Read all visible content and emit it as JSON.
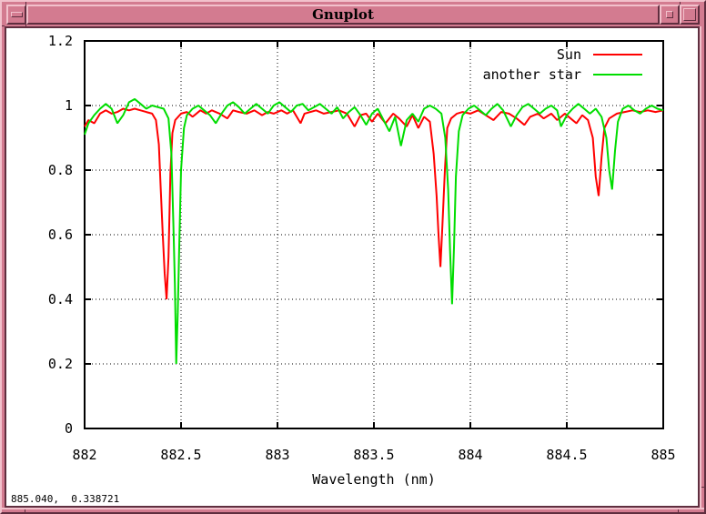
{
  "window": {
    "title": "Gnuplot",
    "icons": {
      "menu_button": "horizontal-dash",
      "minimize_button": "small-square",
      "maximize_button": "large-square"
    }
  },
  "status": {
    "coordinates": "885.040,  0.338721"
  },
  "colors": {
    "frame_face": "#d37b90",
    "frame_light": "#f2c1cc",
    "frame_dark": "#5f2e3f",
    "plot_background": "#ffffff",
    "axis": "#000000",
    "grid": "#000000",
    "sun": "#ff0000",
    "another_star": "#00dd00"
  },
  "chart_data": {
    "type": "line",
    "title": "",
    "xlabel": "Wavelength (nm)",
    "ylabel": "",
    "xlim": [
      882,
      885
    ],
    "ylim": [
      0,
      1.2
    ],
    "grid": "dotted lines at major ticks, mirrored inward ticks on all four borders",
    "legend_position": "inside top-right",
    "x_ticks": {
      "values": [
        882,
        882.5,
        883,
        883.5,
        884,
        884.5,
        885
      ],
      "labels": [
        "882",
        "882.5",
        "883",
        "883.5",
        "884",
        "884.5",
        "885"
      ]
    },
    "y_ticks": {
      "values": [
        0,
        0.2,
        0.4,
        0.6,
        0.8,
        1,
        1.2
      ],
      "labels": [
        "0",
        "0.2",
        "0.4",
        "0.6",
        "0.8",
        "1",
        "1.2"
      ]
    },
    "series": [
      {
        "name": "Sun",
        "color": "#ff0000",
        "points": [
          [
            882.0,
            0.935
          ],
          [
            882.02,
            0.955
          ],
          [
            882.05,
            0.945
          ],
          [
            882.08,
            0.975
          ],
          [
            882.11,
            0.985
          ],
          [
            882.14,
            0.975
          ],
          [
            882.17,
            0.98
          ],
          [
            882.2,
            0.99
          ],
          [
            882.23,
            0.985
          ],
          [
            882.26,
            0.99
          ],
          [
            882.29,
            0.985
          ],
          [
            882.32,
            0.98
          ],
          [
            882.35,
            0.975
          ],
          [
            882.37,
            0.955
          ],
          [
            882.385,
            0.88
          ],
          [
            882.395,
            0.74
          ],
          [
            882.405,
            0.6
          ],
          [
            882.415,
            0.48
          ],
          [
            882.425,
            0.4
          ],
          [
            882.435,
            0.53
          ],
          [
            882.445,
            0.79
          ],
          [
            882.455,
            0.915
          ],
          [
            882.47,
            0.955
          ],
          [
            882.5,
            0.975
          ],
          [
            882.53,
            0.98
          ],
          [
            882.56,
            0.965
          ],
          [
            882.6,
            0.985
          ],
          [
            882.63,
            0.975
          ],
          [
            882.66,
            0.985
          ],
          [
            882.7,
            0.975
          ],
          [
            882.74,
            0.96
          ],
          [
            882.77,
            0.985
          ],
          [
            882.8,
            0.98
          ],
          [
            882.84,
            0.975
          ],
          [
            882.88,
            0.985
          ],
          [
            882.92,
            0.97
          ],
          [
            882.95,
            0.98
          ],
          [
            882.98,
            0.975
          ],
          [
            883.02,
            0.985
          ],
          [
            883.05,
            0.975
          ],
          [
            883.08,
            0.985
          ],
          [
            883.12,
            0.945
          ],
          [
            883.14,
            0.975
          ],
          [
            883.17,
            0.98
          ],
          [
            883.2,
            0.985
          ],
          [
            883.24,
            0.975
          ],
          [
            883.28,
            0.98
          ],
          [
            883.32,
            0.985
          ],
          [
            883.36,
            0.975
          ],
          [
            883.4,
            0.935
          ],
          [
            883.43,
            0.97
          ],
          [
            883.46,
            0.975
          ],
          [
            883.49,
            0.95
          ],
          [
            883.52,
            0.975
          ],
          [
            883.56,
            0.945
          ],
          [
            883.6,
            0.975
          ],
          [
            883.63,
            0.96
          ],
          [
            883.67,
            0.935
          ],
          [
            883.7,
            0.97
          ],
          [
            883.73,
            0.93
          ],
          [
            883.76,
            0.965
          ],
          [
            883.79,
            0.95
          ],
          [
            883.81,
            0.85
          ],
          [
            883.825,
            0.72
          ],
          [
            883.835,
            0.6
          ],
          [
            883.845,
            0.5
          ],
          [
            883.855,
            0.63
          ],
          [
            883.868,
            0.8
          ],
          [
            883.88,
            0.93
          ],
          [
            883.9,
            0.96
          ],
          [
            883.93,
            0.975
          ],
          [
            883.96,
            0.98
          ],
          [
            884.0,
            0.975
          ],
          [
            884.04,
            0.985
          ],
          [
            884.08,
            0.97
          ],
          [
            884.12,
            0.955
          ],
          [
            884.16,
            0.98
          ],
          [
            884.2,
            0.975
          ],
          [
            884.24,
            0.96
          ],
          [
            884.28,
            0.94
          ],
          [
            884.31,
            0.965
          ],
          [
            884.35,
            0.975
          ],
          [
            884.38,
            0.96
          ],
          [
            884.42,
            0.975
          ],
          [
            884.45,
            0.955
          ],
          [
            884.49,
            0.975
          ],
          [
            884.52,
            0.96
          ],
          [
            884.55,
            0.945
          ],
          [
            884.58,
            0.97
          ],
          [
            884.61,
            0.955
          ],
          [
            884.635,
            0.9
          ],
          [
            884.65,
            0.78
          ],
          [
            884.665,
            0.72
          ],
          [
            884.68,
            0.84
          ],
          [
            884.695,
            0.93
          ],
          [
            884.72,
            0.96
          ],
          [
            884.76,
            0.975
          ],
          [
            884.8,
            0.98
          ],
          [
            884.84,
            0.985
          ],
          [
            884.88,
            0.98
          ],
          [
            884.92,
            0.985
          ],
          [
            884.96,
            0.98
          ],
          [
            885.0,
            0.985
          ]
        ]
      },
      {
        "name": "another star",
        "color": "#00dd00",
        "points": [
          [
            882.0,
            0.91
          ],
          [
            882.02,
            0.945
          ],
          [
            882.05,
            0.97
          ],
          [
            882.08,
            0.99
          ],
          [
            882.11,
            1.005
          ],
          [
            882.14,
            0.99
          ],
          [
            882.17,
            0.945
          ],
          [
            882.2,
            0.97
          ],
          [
            882.23,
            1.01
          ],
          [
            882.26,
            1.02
          ],
          [
            882.29,
            1.005
          ],
          [
            882.32,
            0.99
          ],
          [
            882.35,
            1.0
          ],
          [
            882.38,
            0.995
          ],
          [
            882.41,
            0.99
          ],
          [
            882.435,
            0.96
          ],
          [
            882.45,
            0.85
          ],
          [
            882.46,
            0.64
          ],
          [
            882.468,
            0.45
          ],
          [
            882.475,
            0.2
          ],
          [
            882.483,
            0.36
          ],
          [
            882.49,
            0.55
          ],
          [
            882.5,
            0.8
          ],
          [
            882.515,
            0.93
          ],
          [
            882.53,
            0.97
          ],
          [
            882.56,
            0.99
          ],
          [
            882.59,
            1.0
          ],
          [
            882.62,
            0.985
          ],
          [
            882.65,
            0.97
          ],
          [
            882.68,
            0.945
          ],
          [
            882.71,
            0.975
          ],
          [
            882.74,
            1.0
          ],
          [
            882.77,
            1.01
          ],
          [
            882.8,
            0.995
          ],
          [
            882.83,
            0.975
          ],
          [
            882.86,
            0.99
          ],
          [
            882.89,
            1.005
          ],
          [
            882.92,
            0.99
          ],
          [
            882.95,
            0.975
          ],
          [
            882.98,
            1.0
          ],
          [
            883.01,
            1.01
          ],
          [
            883.04,
            0.995
          ],
          [
            883.07,
            0.98
          ],
          [
            883.1,
            1.0
          ],
          [
            883.13,
            1.005
          ],
          [
            883.16,
            0.985
          ],
          [
            883.19,
            0.995
          ],
          [
            883.22,
            1.005
          ],
          [
            883.25,
            0.99
          ],
          [
            883.28,
            0.975
          ],
          [
            883.31,
            0.995
          ],
          [
            883.34,
            0.96
          ],
          [
            883.37,
            0.98
          ],
          [
            883.4,
            0.995
          ],
          [
            883.43,
            0.97
          ],
          [
            883.46,
            0.94
          ],
          [
            883.49,
            0.975
          ],
          [
            883.52,
            0.99
          ],
          [
            883.55,
            0.955
          ],
          [
            883.58,
            0.92
          ],
          [
            883.61,
            0.965
          ],
          [
            883.64,
            0.875
          ],
          [
            883.67,
            0.955
          ],
          [
            883.7,
            0.975
          ],
          [
            883.73,
            0.95
          ],
          [
            883.76,
            0.99
          ],
          [
            883.79,
            1.0
          ],
          [
            883.82,
            0.99
          ],
          [
            883.85,
            0.975
          ],
          [
            883.87,
            0.9
          ],
          [
            883.885,
            0.74
          ],
          [
            883.895,
            0.55
          ],
          [
            883.905,
            0.385
          ],
          [
            883.915,
            0.56
          ],
          [
            883.925,
            0.78
          ],
          [
            883.94,
            0.92
          ],
          [
            883.96,
            0.97
          ],
          [
            883.99,
            0.99
          ],
          [
            884.02,
            1.0
          ],
          [
            884.05,
            0.985
          ],
          [
            884.08,
            0.97
          ],
          [
            884.11,
            0.99
          ],
          [
            884.14,
            1.005
          ],
          [
            884.17,
            0.985
          ],
          [
            884.21,
            0.935
          ],
          [
            884.24,
            0.97
          ],
          [
            884.27,
            0.995
          ],
          [
            884.3,
            1.005
          ],
          [
            884.33,
            0.99
          ],
          [
            884.36,
            0.975
          ],
          [
            884.39,
            0.99
          ],
          [
            884.42,
            1.0
          ],
          [
            884.45,
            0.985
          ],
          [
            884.47,
            0.935
          ],
          [
            884.5,
            0.97
          ],
          [
            884.53,
            0.99
          ],
          [
            884.56,
            1.005
          ],
          [
            884.59,
            0.99
          ],
          [
            884.62,
            0.975
          ],
          [
            884.65,
            0.99
          ],
          [
            884.68,
            0.965
          ],
          [
            884.705,
            0.9
          ],
          [
            884.72,
            0.8
          ],
          [
            884.735,
            0.74
          ],
          [
            884.75,
            0.86
          ],
          [
            884.765,
            0.95
          ],
          [
            884.79,
            0.99
          ],
          [
            884.82,
            1.0
          ],
          [
            884.85,
            0.985
          ],
          [
            884.88,
            0.975
          ],
          [
            884.91,
            0.99
          ],
          [
            884.94,
            1.0
          ],
          [
            884.97,
            0.99
          ],
          [
            885.0,
            0.985
          ]
        ]
      }
    ]
  }
}
